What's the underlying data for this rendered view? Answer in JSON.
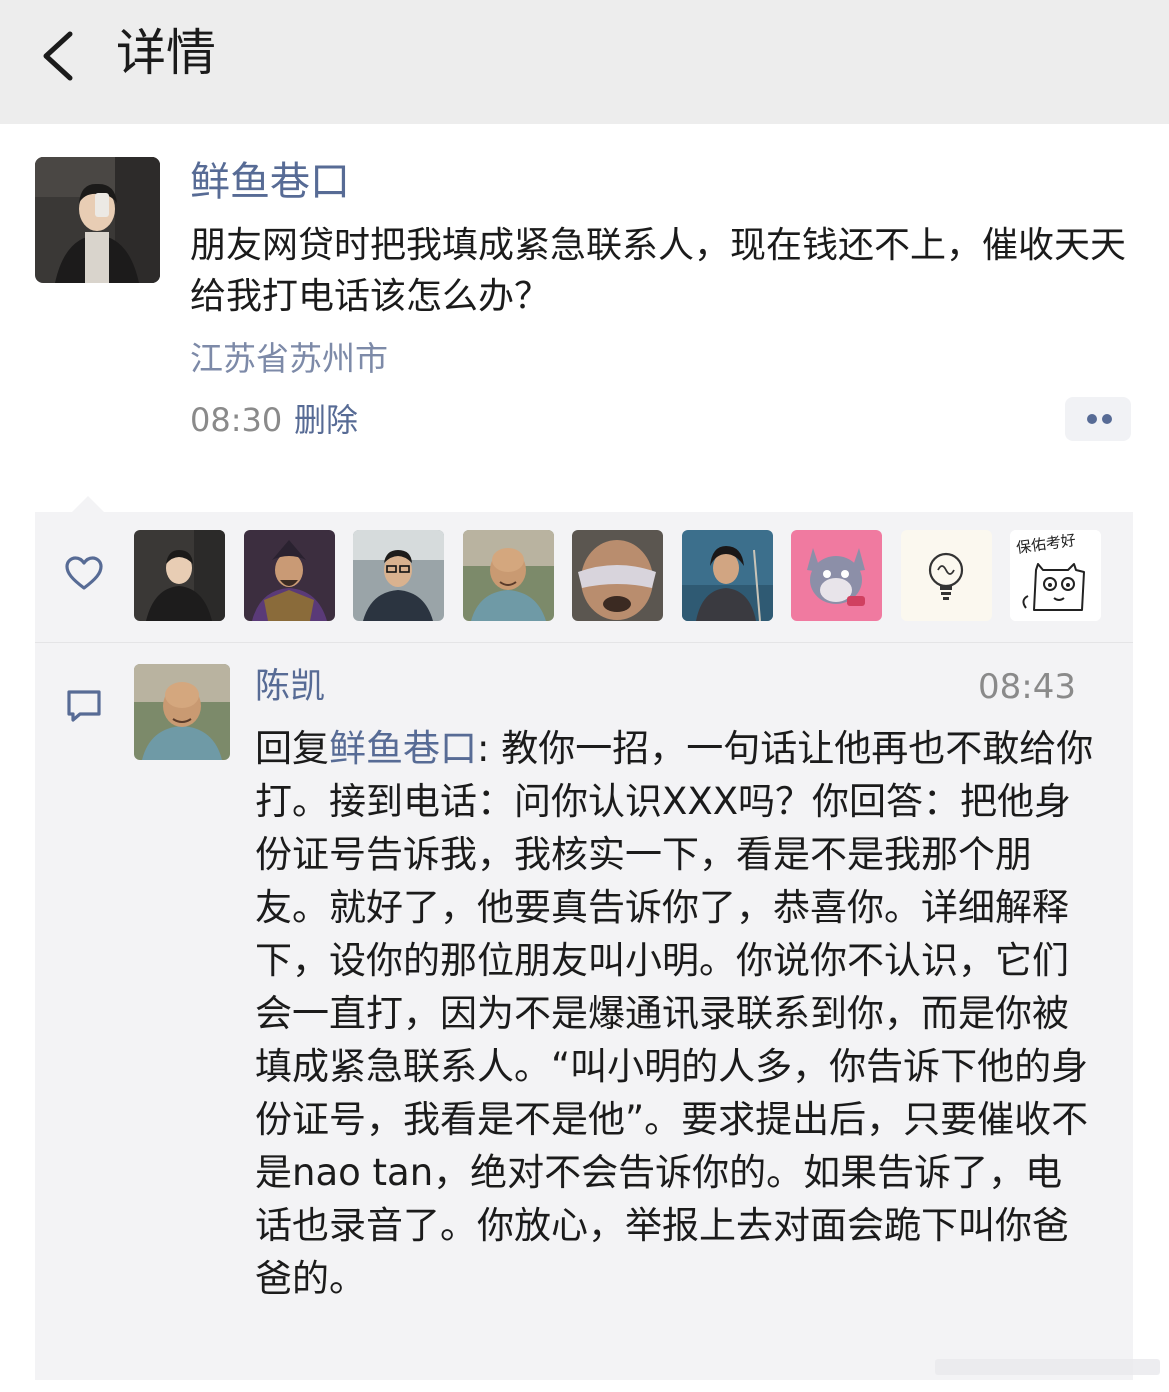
{
  "header": {
    "back_icon": "chevron-left-icon",
    "title": "详情"
  },
  "post": {
    "author": "鲜鱼巷口",
    "text": "朋友网贷时把我填成紧急联系人，现在钱还不上，催收天天给我打电话该怎么办？",
    "location": "江苏省苏州市",
    "time": "08:30",
    "delete_label": "删除",
    "more_icon": "more-dots-icon"
  },
  "likes": {
    "icon": "heart-icon",
    "avatars": [
      {
        "name": "avatar-selfie-user"
      },
      {
        "name": "avatar-armored-warrior"
      },
      {
        "name": "avatar-glasses-man"
      },
      {
        "name": "avatar-bald-man"
      },
      {
        "name": "avatar-eye-mask-man"
      },
      {
        "name": "avatar-boat-man"
      },
      {
        "name": "avatar-cartoon-cat"
      },
      {
        "name": "avatar-lightbulb-brain"
      },
      {
        "name": "avatar-sticker-cat",
        "caption": "保佑考好"
      }
    ]
  },
  "comment": {
    "icon": "comment-icon",
    "author": "陈凯",
    "time": "08:43",
    "reply_prefix": "回复",
    "reply_to": "鲜鱼巷口",
    "text": ": 教你一招，一句话让他再也不敢给你打。接到电话：问你认识XXX吗？你回答：把他身份证号告诉我，我核实一下，看是不是我那个朋友。就好了，他要真告诉你了，恭喜你。详细解释下，设你的那位朋友叫小明。你说你不认识，它们会一直打，因为不是爆通讯录联系到你，而是你被填成紧急联系人。“叫小明的人多，你告诉下他的身份证号，我看是不是他”。要求提出后，只要催收不是nao tan，绝对不会告诉你的。如果告诉了，电话也录音了。你放心，举报上去对面会跪下叫你爸爸的。"
  },
  "colors": {
    "link": "#576b95",
    "header_bg": "#ededed",
    "panel_bg": "#f3f3f5",
    "text": "#1b1b1b",
    "meta": "#8a8a8a"
  }
}
